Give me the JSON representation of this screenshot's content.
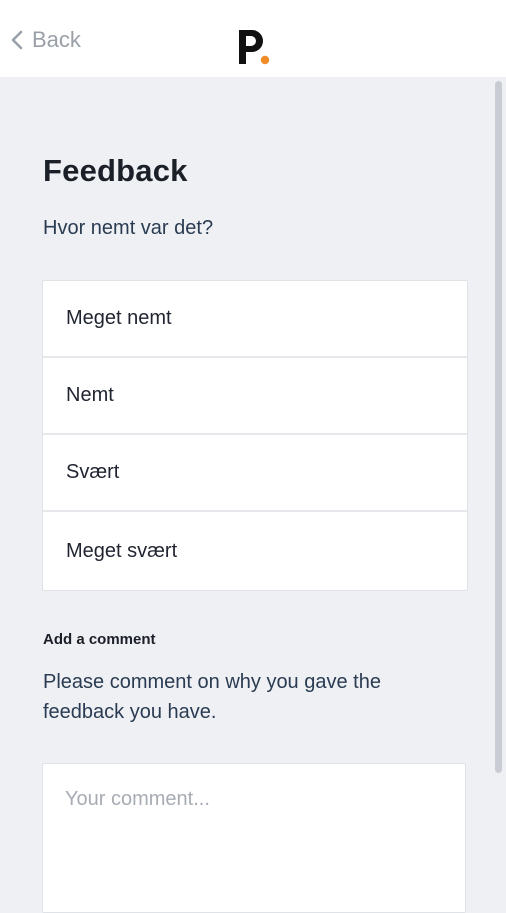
{
  "header": {
    "back_label": "Back"
  },
  "main": {
    "title": "Feedback",
    "question": "Hvor nemt var det?",
    "options": [
      {
        "label": "Meget nemt"
      },
      {
        "label": "Nemt"
      },
      {
        "label": "Svært"
      },
      {
        "label": "Meget svært"
      }
    ],
    "comment": {
      "heading": "Add a comment",
      "description": "Please comment on why you gave the feedback you have.",
      "placeholder": "Your comment...",
      "value": ""
    }
  },
  "colors": {
    "background": "#eef0f4",
    "logo_dot": "#f28c28",
    "text_primary": "#1b1f27",
    "text_secondary": "#2a3b52",
    "back_gray": "#9aa0a8"
  },
  "icons": {
    "back": "chevron-left-icon",
    "logo": "brand-logo"
  }
}
